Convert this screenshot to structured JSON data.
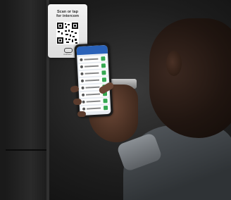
{
  "sign": {
    "line1": "Scan or tap",
    "line2": "for intercom",
    "small": "swiftlane"
  },
  "phone_app": {
    "title": "Swiftlane",
    "rows": 8
  },
  "colors": {
    "app_header": "#2a62b8",
    "unlock_button": "#36a852"
  }
}
